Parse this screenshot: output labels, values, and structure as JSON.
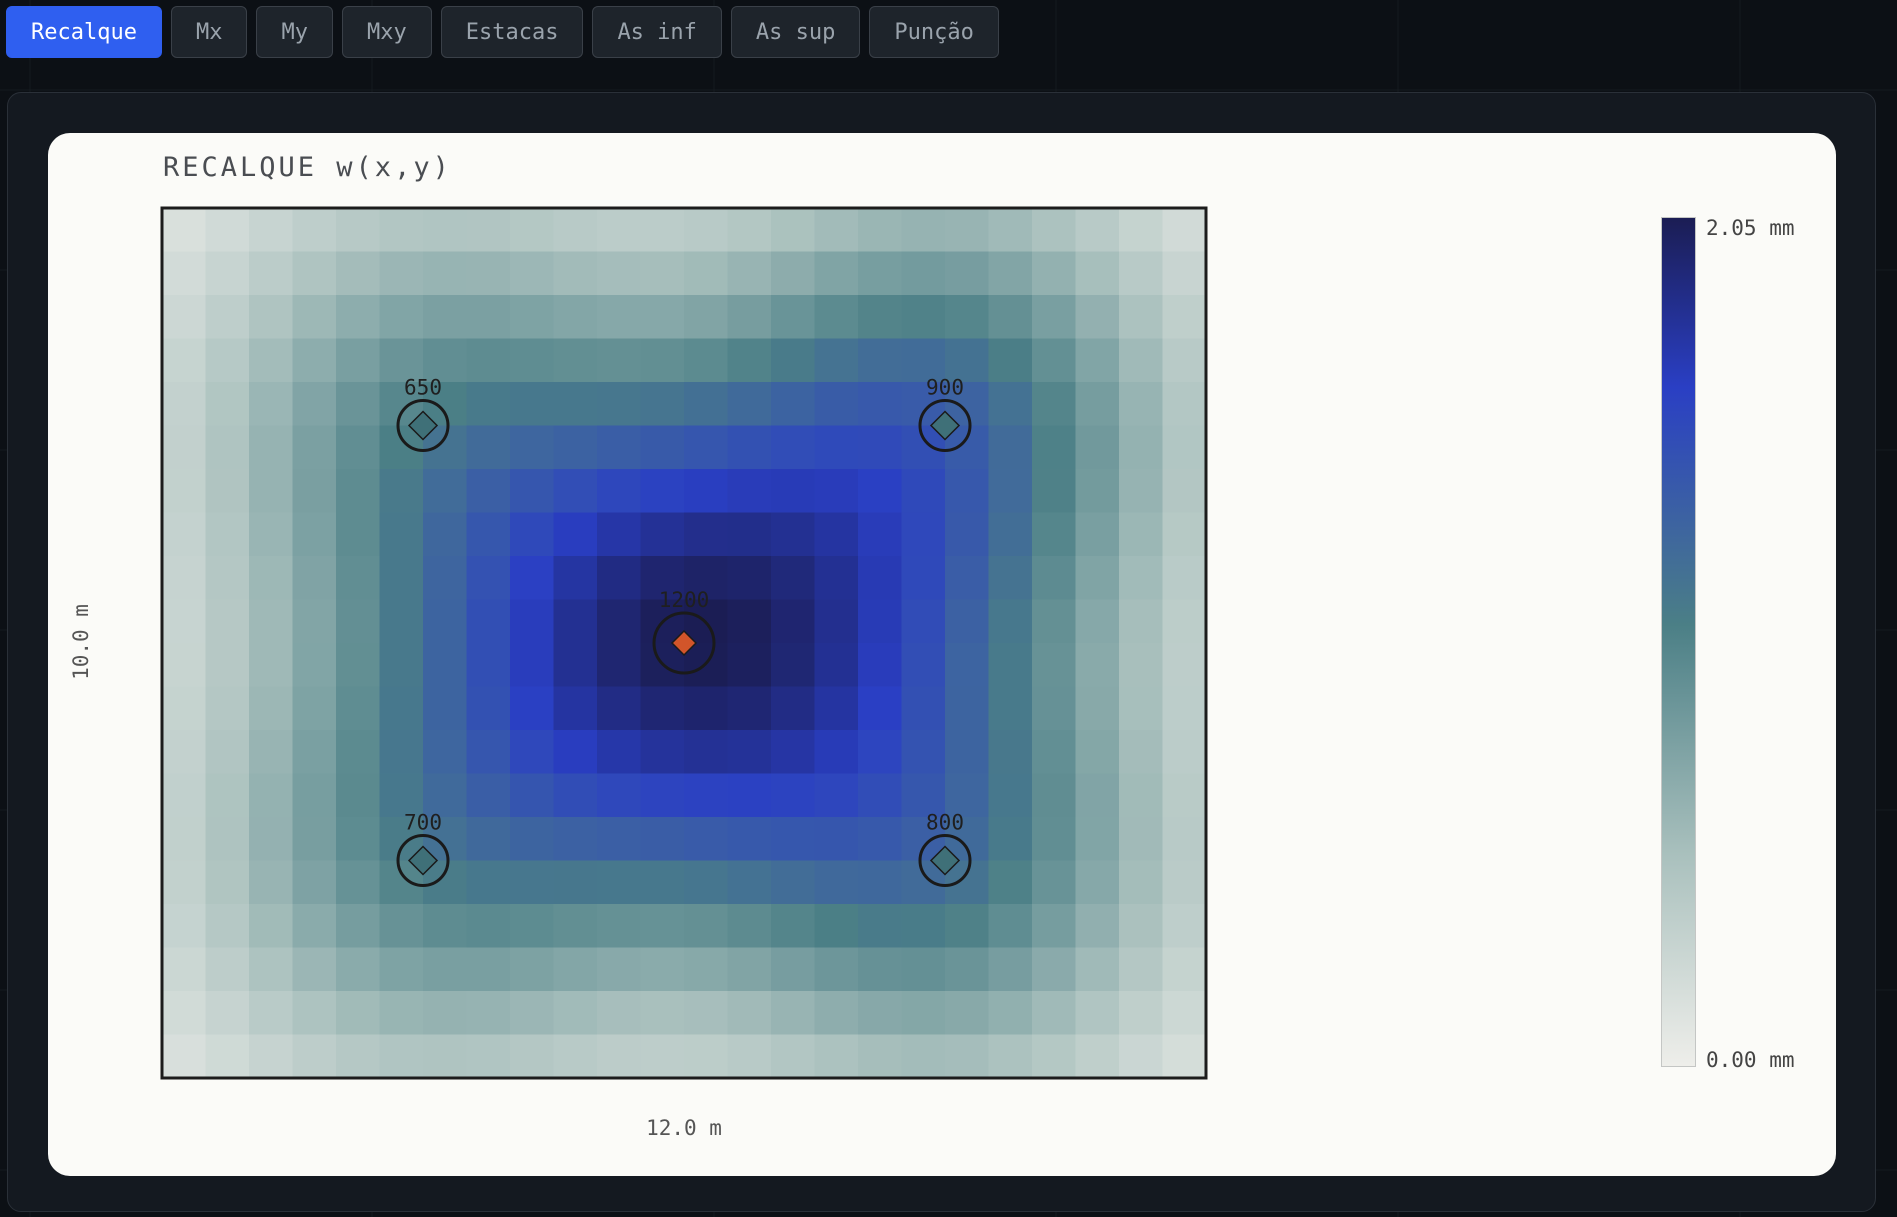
{
  "tabs": [
    {
      "label": "Recalque",
      "active": true
    },
    {
      "label": "Mx",
      "active": false
    },
    {
      "label": "My",
      "active": false
    },
    {
      "label": "Mxy",
      "active": false
    },
    {
      "label": "Estacas",
      "active": false
    },
    {
      "label": "As inf",
      "active": false
    },
    {
      "label": "As sup",
      "active": false
    },
    {
      "label": "Punção",
      "active": false
    }
  ],
  "plot": {
    "title": "RECALQUE w(x,y)",
    "xlabel": "12.0 m",
    "ylabel": "10.0 m",
    "colorbar": {
      "max_label": "2.05 mm",
      "min_label": "0.00 mm"
    }
  },
  "colors": {
    "accent": "#2f5ff0",
    "colormap": [
      "#eeeeea",
      "#a9c0bd",
      "#4b7f86",
      "#2a3fc4",
      "#1b1d54"
    ],
    "pile_normal": "#3f7078",
    "pile_max": "#d2552a"
  },
  "chart_data": {
    "type": "heatmap",
    "title": "RECALQUE w(x,y)",
    "xlabel": "12.0 m",
    "ylabel": "10.0 m",
    "x_range_m": [
      0,
      12
    ],
    "y_range_m": [
      0,
      10
    ],
    "grid_cells": [
      24,
      20
    ],
    "value_range_mm": [
      0,
      2.05
    ],
    "colorbar_labels": [
      "2.05 mm",
      "0.00 mm"
    ],
    "piles": [
      {
        "label": "650",
        "x": 3.0,
        "y": 7.5,
        "settlement_mm": 1.12,
        "highlight": false
      },
      {
        "label": "900",
        "x": 9.0,
        "y": 7.5,
        "settlement_mm": 1.55,
        "highlight": false
      },
      {
        "label": "1200",
        "x": 6.0,
        "y": 5.0,
        "settlement_mm": 2.05,
        "highlight": true
      },
      {
        "label": "700",
        "x": 3.0,
        "y": 2.5,
        "settlement_mm": 1.15,
        "highlight": false
      },
      {
        "label": "800",
        "x": 9.0,
        "y": 2.5,
        "settlement_mm": 1.35,
        "highlight": false
      }
    ]
  }
}
